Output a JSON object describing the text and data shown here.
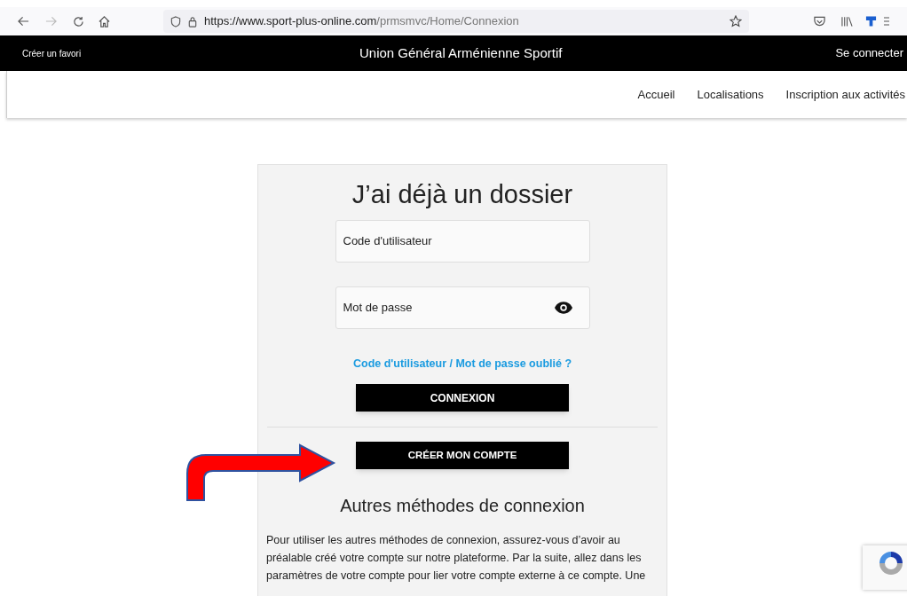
{
  "browser": {
    "url_host": "https://www.sport-plus-online.com",
    "url_path": "/prmsmvc/Home/Connexion"
  },
  "header": {
    "left_link": "Créer un favori",
    "title": "Union Général Arménienne Sportif",
    "right_link": "Se connecter"
  },
  "nav": {
    "items": [
      "Accueil",
      "Localisations",
      "Inscription aux activités"
    ]
  },
  "login": {
    "title": "J’ai déjà un dossier",
    "fields": [
      {
        "placeholder": "Code d'utilisateur",
        "kind": "text"
      },
      {
        "placeholder": "Mot de passe",
        "kind": "password"
      }
    ],
    "forgot_link": "Code d'utilisateur / Mot de passe oublié ?",
    "login_button": "CONNEXION",
    "create_button": "CRÉER MON COMPTE",
    "other_heading": "Autres méthodes de connexion",
    "other_text": [
      "Pour utiliser les autres méthodes de connexion, assurez-vous d’avoir au",
      "préalable créé votre compte sur notre plateforme. Par la suite, allez dans les",
      "paramètres de votre compte pour lier votre compte externe à ce compte. Une"
    ]
  }
}
